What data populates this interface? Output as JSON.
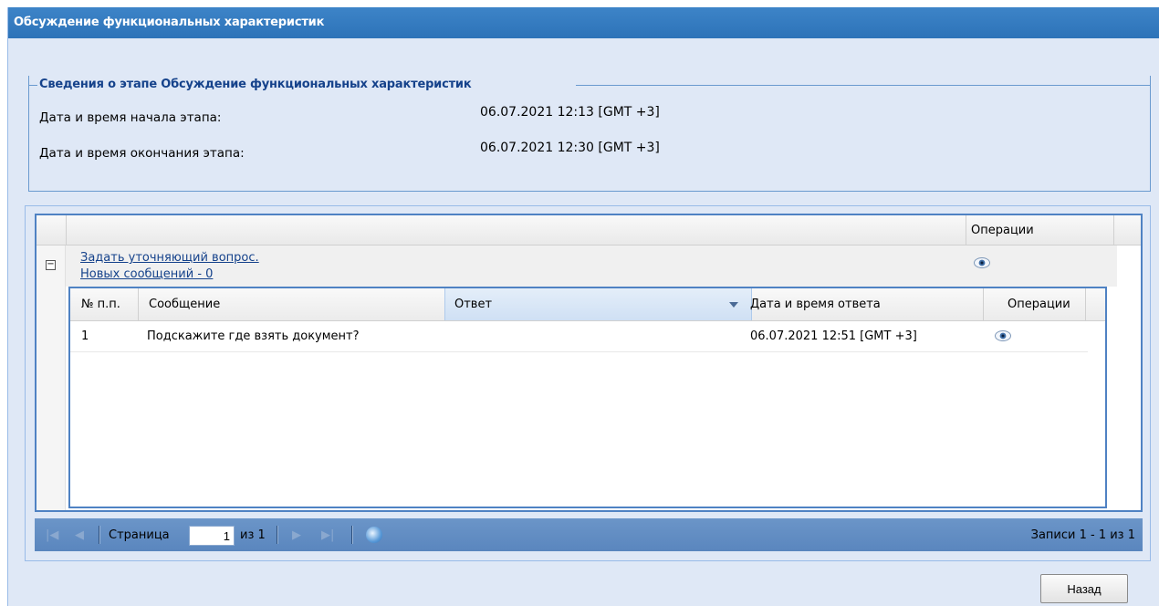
{
  "window": {
    "title": "Обсуждение функциональных характеристик"
  },
  "info": {
    "legend": "Сведения о этапе Обсуждение функциональных характеристик",
    "start_label": "Дата и время начала этапа:",
    "start_value": "06.07.2021 12:13 [GMT +3]",
    "end_label": "Дата и время окончания этапа:",
    "end_value": "06.07.2021 12:30 [GMT +3]"
  },
  "outer_grid": {
    "operations_header": "Операции",
    "group": {
      "ask_link": "Задать уточняющий вопрос.",
      "new_messages_link": "Новых сообщений - 0"
    }
  },
  "inner_grid": {
    "columns": [
      "№ п.п.",
      "Сообщение",
      "Ответ",
      "Дата и время ответа",
      "Операции"
    ],
    "rows": [
      {
        "num": "1",
        "message": "Подскажите где взять документ?",
        "answer": "",
        "answer_time": "06.07.2021 12:51 [GMT +3]"
      }
    ]
  },
  "pager": {
    "page_label": "Страница",
    "page_value": "1",
    "of_label": "из 1",
    "records": "Записи 1 - 1 из 1"
  },
  "buttons": {
    "back": "Назад"
  },
  "icons": {
    "first": "first-page-icon",
    "prev": "prev-page-icon",
    "next": "next-page-icon",
    "last": "last-page-icon",
    "refresh": "refresh-icon",
    "view": "eye-icon",
    "collapse": "minus-icon"
  },
  "colors": {
    "header": "#2d73b8",
    "panel_bg": "#dfe8f6",
    "link": "#15428b",
    "pager": "#6b95c8"
  }
}
